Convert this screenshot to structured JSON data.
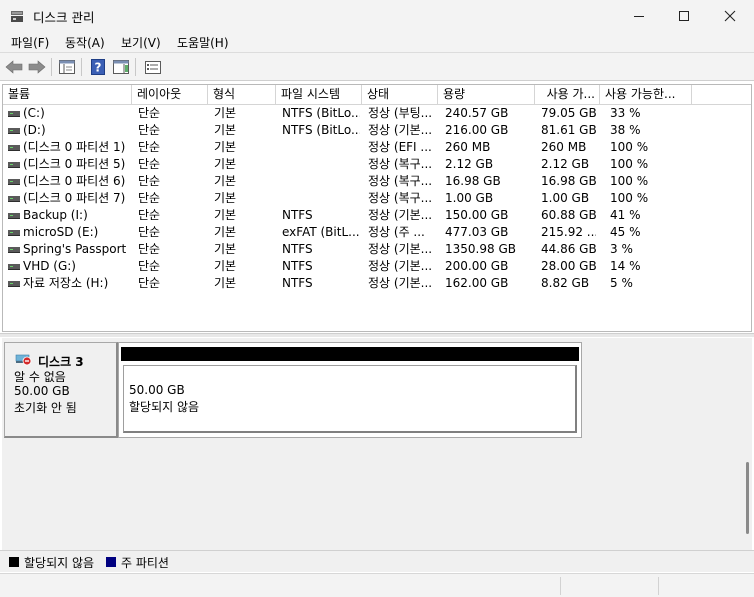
{
  "window": {
    "title": "디스크 관리",
    "icon": "disk-management-icon",
    "controls": [
      "minimize-icon",
      "maximize-icon",
      "close-icon"
    ]
  },
  "menu": [
    {
      "label": "파일(F)"
    },
    {
      "label": "동작(A)"
    },
    {
      "label": "보기(V)"
    },
    {
      "label": "도움말(H)"
    }
  ],
  "toolbar": {
    "buttons": [
      "back-arrow-icon",
      "forward-arrow-icon",
      "console-pane-icon",
      "help-icon",
      "action-pane-icon",
      "properties-icon"
    ]
  },
  "volume_list": {
    "columns": [
      "볼륨",
      "레이아웃",
      "형식",
      "파일 시스템",
      "상태",
      "용량",
      "사용 가...",
      "사용 가능한..."
    ],
    "rows": [
      [
        "(C:)",
        "단순",
        "기본",
        "NTFS (BitLo...",
        "정상 (부팅...",
        "240.57 GB",
        "79.05 GB",
        "33 %"
      ],
      [
        "(D:)",
        "단순",
        "기본",
        "NTFS (BitLo...",
        "정상 (기본...",
        "216.00 GB",
        "81.61 GB",
        "38 %"
      ],
      [
        "(디스크 0 파티션 1)",
        "단순",
        "기본",
        "",
        "정상 (EFI ...",
        "260 MB",
        "260 MB",
        "100 %"
      ],
      [
        "(디스크 0 파티션 5)",
        "단순",
        "기본",
        "",
        "정상 (복구...",
        "2.12 GB",
        "2.12 GB",
        "100 %"
      ],
      [
        "(디스크 0 파티션 6)",
        "단순",
        "기본",
        "",
        "정상 (복구...",
        "16.98 GB",
        "16.98 GB",
        "100 %"
      ],
      [
        "(디스크 0 파티션 7)",
        "단순",
        "기본",
        "",
        "정상 (복구...",
        "1.00 GB",
        "1.00 GB",
        "100 %"
      ],
      [
        "Backup (I:)",
        "단순",
        "기본",
        "NTFS",
        "정상 (기본...",
        "150.00 GB",
        "60.88 GB",
        "41 %"
      ],
      [
        "microSD (E:)",
        "단순",
        "기본",
        "exFAT (BitL...",
        "정상 (주 ...",
        "477.03 GB",
        "215.92 ...",
        "45 %"
      ],
      [
        "Spring's Passport ...",
        "단순",
        "기본",
        "NTFS",
        "정상 (기본...",
        "1350.98 GB",
        "44.86 GB",
        "3 %"
      ],
      [
        "VHD (G:)",
        "단순",
        "기본",
        "NTFS",
        "정상 (기본...",
        "200.00 GB",
        "28.00 GB",
        "14 %"
      ],
      [
        "자료 저장소 (H:)",
        "단순",
        "기본",
        "NTFS",
        "정상 (기본...",
        "162.00 GB",
        "8.82 GB",
        "5 %"
      ]
    ]
  },
  "disk": {
    "name": "디스크 3",
    "type": "알 수 없음",
    "size": "50.00 GB",
    "state": "초기화 안 됨",
    "icon": "disk-uninitialized-icon",
    "partition": {
      "size": "50.00 GB",
      "status": "할당되지 않음",
      "header_color": "#000000"
    }
  },
  "legend": [
    {
      "label": "할당되지 않음",
      "color": "#000000"
    },
    {
      "label": "주 파티션",
      "color": "#000080"
    }
  ]
}
